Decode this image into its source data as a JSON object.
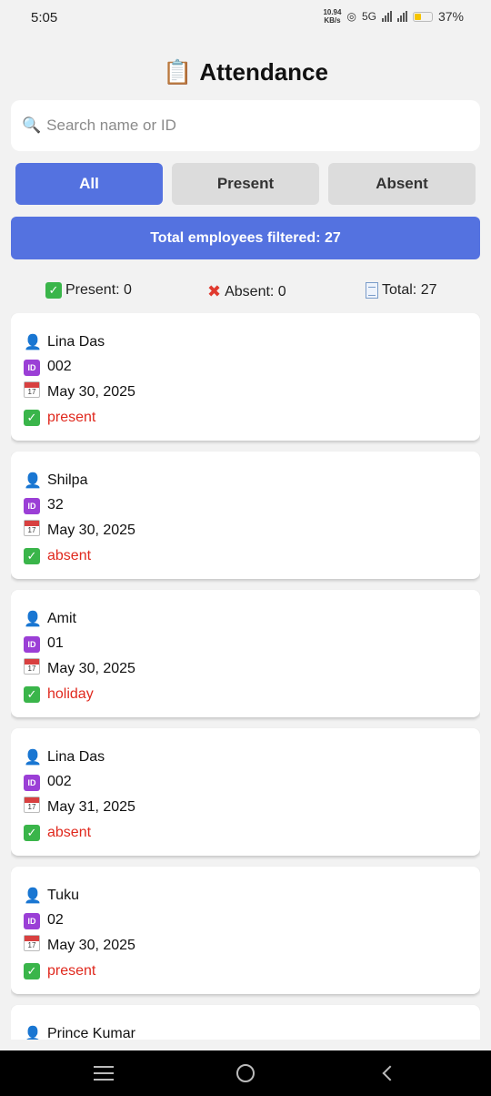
{
  "status_bar": {
    "time": "5:05",
    "net_speed_value": "10.94",
    "net_speed_unit": "KB/s",
    "network": "5G",
    "battery": "37%"
  },
  "header": {
    "title": "Attendance",
    "title_icon": "clipboard-icon"
  },
  "search": {
    "placeholder": "Search name or ID",
    "value": ""
  },
  "filters": {
    "all": "All",
    "present": "Present",
    "absent": "Absent",
    "selected": "All"
  },
  "banner": {
    "text": "Total employees filtered: 27"
  },
  "stats": {
    "present": "Present: 0",
    "absent": "Absent: 0",
    "total": "Total: 27"
  },
  "records": [
    {
      "name": "Lina Das",
      "id": "002",
      "date": "May 30, 2025",
      "status": "present"
    },
    {
      "name": "Shilpa",
      "id": "32",
      "date": "May 30, 2025",
      "status": "absent"
    },
    {
      "name": "Amit",
      "id": "01",
      "date": "May 30, 2025",
      "status": "holiday"
    },
    {
      "name": "Lina Das",
      "id": "002",
      "date": "May 31, 2025",
      "status": "absent"
    },
    {
      "name": "Tuku",
      "id": "02",
      "date": "May 30, 2025",
      "status": "present"
    },
    {
      "name": "Prince Kumar",
      "id": "",
      "date": "",
      "status": ""
    }
  ],
  "colors": {
    "accent": "#5472e0",
    "status_text": "#e0291e",
    "inactive_button": "#dcdcdc"
  }
}
